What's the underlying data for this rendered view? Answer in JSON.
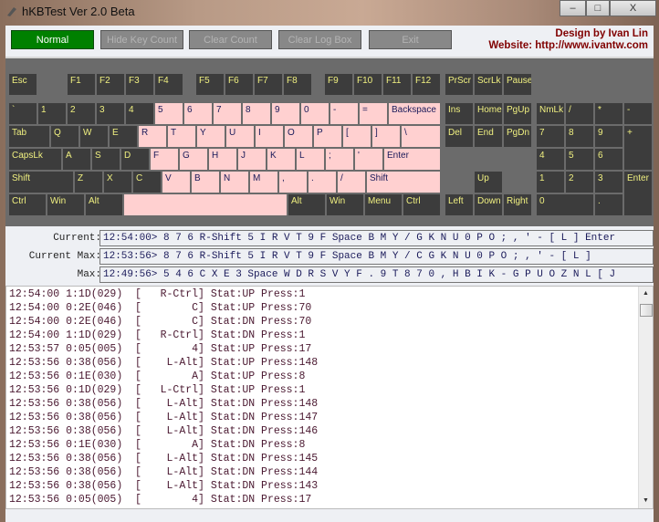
{
  "window": {
    "title": "hKBTest Ver 2.0 Beta",
    "minimize": "–",
    "maximize": "□",
    "close": "X"
  },
  "toolbar": {
    "buttons": [
      "Normal",
      "Hide Key Count",
      "Clear Count",
      "Clear Log Box",
      "Exit"
    ],
    "credit_line1": "Design by Ivan Lin",
    "credit_line2": "Website: http://www.ivantw.com"
  },
  "colors": {
    "key": "#3c3c3c",
    "key_pressed": "#ffd0d0",
    "key_label": "#f0f080",
    "normal_button": "#008000",
    "credit": "#800000"
  },
  "keys": [
    {
      "label": "Esc",
      "pressed": false
    },
    {
      "label": "F1",
      "pressed": false
    },
    {
      "label": "F2",
      "pressed": false
    },
    {
      "label": "F3",
      "pressed": false
    },
    {
      "label": "F4",
      "pressed": false
    },
    {
      "label": "F5",
      "pressed": false
    },
    {
      "label": "F6",
      "pressed": false
    },
    {
      "label": "F7",
      "pressed": false
    },
    {
      "label": "F8",
      "pressed": false
    },
    {
      "label": "F9",
      "pressed": false
    },
    {
      "label": "F10",
      "pressed": false
    },
    {
      "label": "F11",
      "pressed": false
    },
    {
      "label": "F12",
      "pressed": false
    },
    {
      "label": "PrScr",
      "pressed": false
    },
    {
      "label": "ScrLk",
      "pressed": false
    },
    {
      "label": "Pause",
      "pressed": false
    },
    {
      "label": "`",
      "pressed": false
    },
    {
      "label": "1",
      "pressed": false
    },
    {
      "label": "2",
      "pressed": false
    },
    {
      "label": "3",
      "pressed": false
    },
    {
      "label": "4",
      "pressed": false
    },
    {
      "label": "5",
      "pressed": true
    },
    {
      "label": "6",
      "pressed": true
    },
    {
      "label": "7",
      "pressed": true
    },
    {
      "label": "8",
      "pressed": true
    },
    {
      "label": "9",
      "pressed": true
    },
    {
      "label": "0",
      "pressed": true
    },
    {
      "label": "-",
      "pressed": true
    },
    {
      "label": "=",
      "pressed": true
    },
    {
      "label": "Backspace",
      "pressed": true
    },
    {
      "label": "Ins",
      "pressed": false
    },
    {
      "label": "Home",
      "pressed": false
    },
    {
      "label": "PgUp",
      "pressed": false
    },
    {
      "label": "NmLk",
      "pressed": false
    },
    {
      "label": "/",
      "pressed": false
    },
    {
      "label": "*",
      "pressed": false
    },
    {
      "label": "-",
      "pressed": false
    },
    {
      "label": "Tab",
      "pressed": false
    },
    {
      "label": "Q",
      "pressed": false
    },
    {
      "label": "W",
      "pressed": false
    },
    {
      "label": "E",
      "pressed": false
    },
    {
      "label": "R",
      "pressed": true
    },
    {
      "label": "T",
      "pressed": true
    },
    {
      "label": "Y",
      "pressed": true
    },
    {
      "label": "U",
      "pressed": true
    },
    {
      "label": "I",
      "pressed": true
    },
    {
      "label": "O",
      "pressed": true
    },
    {
      "label": "P",
      "pressed": true
    },
    {
      "label": "[",
      "pressed": true
    },
    {
      "label": "]",
      "pressed": true
    },
    {
      "label": "\\",
      "pressed": true
    },
    {
      "label": "Del",
      "pressed": false
    },
    {
      "label": "End",
      "pressed": false
    },
    {
      "label": "PgDn",
      "pressed": false
    },
    {
      "label": "7",
      "pressed": false
    },
    {
      "label": "8",
      "pressed": false
    },
    {
      "label": "9",
      "pressed": false
    },
    {
      "label": "+",
      "pressed": false
    },
    {
      "label": "CapsLk",
      "pressed": false
    },
    {
      "label": "A",
      "pressed": false
    },
    {
      "label": "S",
      "pressed": false
    },
    {
      "label": "D",
      "pressed": false
    },
    {
      "label": "F",
      "pressed": true
    },
    {
      "label": "G",
      "pressed": true
    },
    {
      "label": "H",
      "pressed": true
    },
    {
      "label": "J",
      "pressed": true
    },
    {
      "label": "K",
      "pressed": true
    },
    {
      "label": "L",
      "pressed": true
    },
    {
      "label": ";",
      "pressed": true
    },
    {
      "label": "'",
      "pressed": true
    },
    {
      "label": "Enter",
      "pressed": true
    },
    {
      "label": "4",
      "pressed": false
    },
    {
      "label": "5",
      "pressed": false
    },
    {
      "label": "6",
      "pressed": false
    },
    {
      "label": "Shift",
      "pressed": false
    },
    {
      "label": "Z",
      "pressed": false
    },
    {
      "label": "X",
      "pressed": false
    },
    {
      "label": "C",
      "pressed": false
    },
    {
      "label": "V",
      "pressed": true
    },
    {
      "label": "B",
      "pressed": true
    },
    {
      "label": "N",
      "pressed": true
    },
    {
      "label": "M",
      "pressed": true
    },
    {
      "label": ",",
      "pressed": true
    },
    {
      "label": ".",
      "pressed": true
    },
    {
      "label": "/",
      "pressed": true
    },
    {
      "label": "Shift",
      "pressed": true
    },
    {
      "label": "Up",
      "pressed": false
    },
    {
      "label": "1",
      "pressed": false
    },
    {
      "label": "2",
      "pressed": false
    },
    {
      "label": "3",
      "pressed": false
    },
    {
      "label": "Enter",
      "pressed": false
    },
    {
      "label": "Ctrl",
      "pressed": false
    },
    {
      "label": "Win",
      "pressed": false
    },
    {
      "label": "Alt",
      "pressed": false
    },
    {
      "label": "",
      "pressed": true
    },
    {
      "label": "Alt",
      "pressed": false
    },
    {
      "label": "Win",
      "pressed": false
    },
    {
      "label": "Menu",
      "pressed": false
    },
    {
      "label": "Ctrl",
      "pressed": false
    },
    {
      "label": "Left",
      "pressed": false
    },
    {
      "label": "Down",
      "pressed": false
    },
    {
      "label": "Right",
      "pressed": false
    },
    {
      "label": "0",
      "pressed": false
    },
    {
      "label": ".",
      "pressed": false
    }
  ],
  "fields": [
    {
      "label": "Current:",
      "value": "12:54:00> 8 7 6 R-Shift 5 I R V T 9 F Space B M Y / G K N U 0 P O ; , ' - [ L ] Enter"
    },
    {
      "label": "Current Max:",
      "value": "12:53:56> 8 7 6 R-Shift 5 I R V T 9 F Space B M Y / C G K N U 0 P O ; , ' - [ L ]"
    },
    {
      "label": "Max:",
      "value": "12:49:56> 5 4 6 C X E 3 Space W D R S V Y F . 9 T 8 7 0 , H B I K - G P U O Z N L [ J"
    }
  ],
  "log": [
    "12:54:00 1:1D(029)  [   R-Ctrl] Stat:UP Press:1",
    "12:54:00 0:2E(046)  [        C] Stat:UP Press:70",
    "12:54:00 0:2E(046)  [        C] Stat:DN Press:70",
    "12:54:00 1:1D(029)  [   R-Ctrl] Stat:DN Press:1",
    "12:53:57 0:05(005)  [        4] Stat:UP Press:17",
    "12:53:56 0:38(056)  [    L-Alt] Stat:UP Press:148",
    "12:53:56 0:1E(030)  [        A] Stat:UP Press:8",
    "12:53:56 0:1D(029)  [   L-Ctrl] Stat:UP Press:1",
    "12:53:56 0:38(056)  [    L-Alt] Stat:DN Press:148",
    "12:53:56 0:38(056)  [    L-Alt] Stat:DN Press:147",
    "12:53:56 0:38(056)  [    L-Alt] Stat:DN Press:146",
    "12:53:56 0:1E(030)  [        A] Stat:DN Press:8",
    "12:53:56 0:38(056)  [    L-Alt] Stat:DN Press:145",
    "12:53:56 0:38(056)  [    L-Alt] Stat:DN Press:144",
    "12:53:56 0:38(056)  [    L-Alt] Stat:DN Press:143",
    "12:53:56 0:05(005)  [        4] Stat:DN Press:17"
  ]
}
